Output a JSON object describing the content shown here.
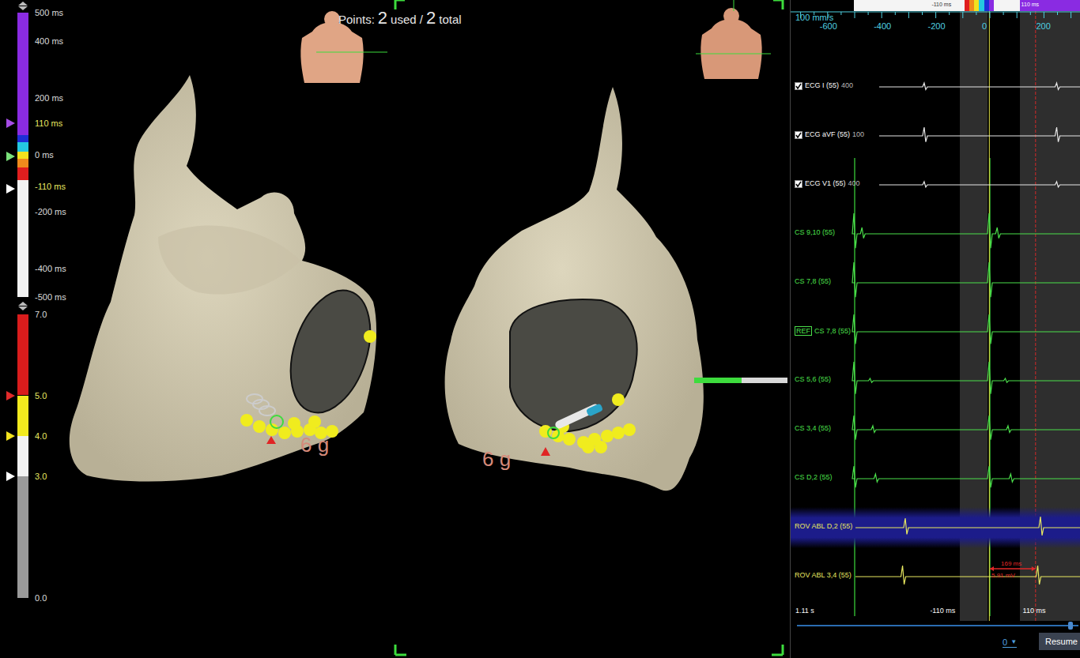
{
  "map": {
    "points_label": "Points:",
    "points_used": "2",
    "used_label": "used /",
    "points_total": "2",
    "total_label": "total",
    "views": [
      {
        "force": "6 g"
      },
      {
        "force": "6 g"
      }
    ]
  },
  "lat_scale": {
    "labels": [
      "500 ms",
      "400 ms",
      "200 ms",
      "110 ms",
      "0 ms",
      "-110 ms",
      "-200 ms",
      "-400 ms",
      "-500 ms"
    ],
    "highlighted": [
      "110 ms",
      "-110 ms"
    ],
    "bands": [
      {
        "from": 500,
        "to": 70,
        "color": "#8a2be2"
      },
      {
        "from": 70,
        "to": 45,
        "color": "#1d2fd6"
      },
      {
        "from": 45,
        "to": 10,
        "color": "#24c8e0"
      },
      {
        "from": 10,
        "to": -15,
        "color": "#f2e21e"
      },
      {
        "from": -15,
        "to": -45,
        "color": "#f08a1c"
      },
      {
        "from": -45,
        "to": -90,
        "color": "#e01e1e"
      },
      {
        "from": -90,
        "to": -500,
        "color": "#f2f2f2"
      }
    ],
    "markers": [
      {
        "value": 110,
        "color": "#a64de6"
      },
      {
        "value": -5,
        "color": "#7ae07a"
      },
      {
        "value": -120,
        "color": "#ffffff"
      }
    ]
  },
  "force_scale": {
    "labels": [
      "7.0",
      "5.0",
      "4.0",
      "3.0",
      "0.0"
    ],
    "highlighted": [
      "5.0",
      "4.0",
      "3.0"
    ],
    "bands": [
      {
        "from": 7,
        "to": 5,
        "color": "#d91c1c"
      },
      {
        "from": 5,
        "to": 4,
        "color": "#f2ea1e"
      },
      {
        "from": 4,
        "to": 3,
        "color": "#f2f2f2"
      },
      {
        "from": 3,
        "to": 0,
        "color": "#9a9a9a"
      }
    ],
    "markers": [
      {
        "value": 5,
        "color": "#e02a2a"
      },
      {
        "value": 4,
        "color": "#f2e21e"
      },
      {
        "value": 3,
        "color": "#ffffff"
      }
    ]
  },
  "signals": {
    "speed": "100 mm/s",
    "ticks": [
      "-600",
      "-400",
      "-200",
      "0",
      "200"
    ],
    "window_left": "-110 ms",
    "window_right": "110 ms",
    "lines": [
      {
        "t": -500,
        "color": "#3ddc3d"
      },
      {
        "t": 0,
        "color": "#3ddc3d"
      },
      {
        "t": -2,
        "color": "#e8e84a"
      },
      {
        "t": 169,
        "color": "#d02828"
      }
    ],
    "channels": [
      {
        "label": "ECG I (55)",
        "gain": "400",
        "kind": "ecg",
        "checked": true,
        "ref": false,
        "selected": false,
        "color": "#e6e6e6",
        "beats": [
          {
            "t": -240,
            "a": 5
          },
          {
            "t": 250,
            "a": 5
          }
        ]
      },
      {
        "label": "ECG aVF (55)",
        "gain": "100",
        "kind": "ecg",
        "checked": true,
        "ref": false,
        "selected": false,
        "color": "#e6e6e6",
        "beats": [
          {
            "t": -240,
            "a": 11
          },
          {
            "t": 250,
            "a": 11
          }
        ]
      },
      {
        "label": "ECG V1 (55)",
        "gain": "400",
        "kind": "ecg",
        "checked": true,
        "ref": false,
        "selected": false,
        "color": "#e6e6e6",
        "beats": [
          {
            "t": -240,
            "a": 4
          },
          {
            "t": 250,
            "a": 4
          }
        ]
      },
      {
        "label": "CS 9,10 (55)",
        "gain": "",
        "kind": "cs",
        "checked": false,
        "ref": false,
        "selected": false,
        "color": "#4be04b",
        "beats": [
          {
            "t": -500,
            "a": 26
          },
          {
            "t": -470,
            "a": 8
          },
          {
            "t": 0,
            "a": 26
          },
          {
            "t": 30,
            "a": 8
          }
        ]
      },
      {
        "label": "CS 7,8 (55)",
        "gain": "",
        "kind": "cs",
        "checked": false,
        "ref": false,
        "selected": false,
        "color": "#4be04b",
        "beats": [
          {
            "t": -500,
            "a": 26
          },
          {
            "t": 0,
            "a": 26
          }
        ]
      },
      {
        "label": "CS 7,8 (55)",
        "gain": "",
        "kind": "cs",
        "checked": false,
        "ref": true,
        "ref_label": "REF",
        "selected": false,
        "color": "#4be04b",
        "beats": [
          {
            "t": -500,
            "a": 22
          },
          {
            "t": 0,
            "a": 22
          }
        ]
      },
      {
        "label": "CS 5,6 (55)",
        "gain": "",
        "kind": "cs",
        "checked": false,
        "ref": false,
        "selected": false,
        "color": "#4be04b",
        "beats": [
          {
            "t": -500,
            "a": 24
          },
          {
            "t": -440,
            "a": 3
          },
          {
            "t": 0,
            "a": 24
          },
          {
            "t": 60,
            "a": 3
          }
        ]
      },
      {
        "label": "CS 3,4 (55)",
        "gain": "",
        "kind": "cs",
        "checked": false,
        "ref": false,
        "selected": false,
        "color": "#4be04b",
        "beats": [
          {
            "t": -500,
            "a": 18
          },
          {
            "t": -430,
            "a": 5
          },
          {
            "t": 0,
            "a": 18
          },
          {
            "t": 70,
            "a": 5
          }
        ]
      },
      {
        "label": "CS D,2 (55)",
        "gain": "",
        "kind": "cs",
        "checked": false,
        "ref": false,
        "selected": false,
        "color": "#4be04b",
        "beats": [
          {
            "t": -500,
            "a": 16
          },
          {
            "t": -420,
            "a": 6
          },
          {
            "t": 0,
            "a": 16
          },
          {
            "t": 80,
            "a": 6
          }
        ]
      },
      {
        "label": "ROV ABL D,2 (55)",
        "gain": "",
        "kind": "abl",
        "checked": false,
        "ref": false,
        "selected": true,
        "color": "#e8e860",
        "beats": [
          {
            "t": -310,
            "a": 12
          },
          {
            "t": 190,
            "a": 14
          }
        ]
      },
      {
        "label": "ROV ABL 3,4 (55)",
        "gain": "",
        "kind": "abl",
        "checked": false,
        "ref": false,
        "selected": false,
        "color": "#e8e860",
        "beats": [
          {
            "t": -320,
            "a": 14
          },
          {
            "t": 180,
            "a": 14
          }
        ]
      }
    ],
    "measure": {
      "interval": "169 ms",
      "voltage": "5.91 mV",
      "from": 0,
      "to": 169
    },
    "footer": {
      "duration": "1.11 s",
      "left": "-110 ms",
      "right": "110 ms",
      "value": "0",
      "dropdown": "▼",
      "resume": "Resume",
      "level": 0.98
    }
  }
}
